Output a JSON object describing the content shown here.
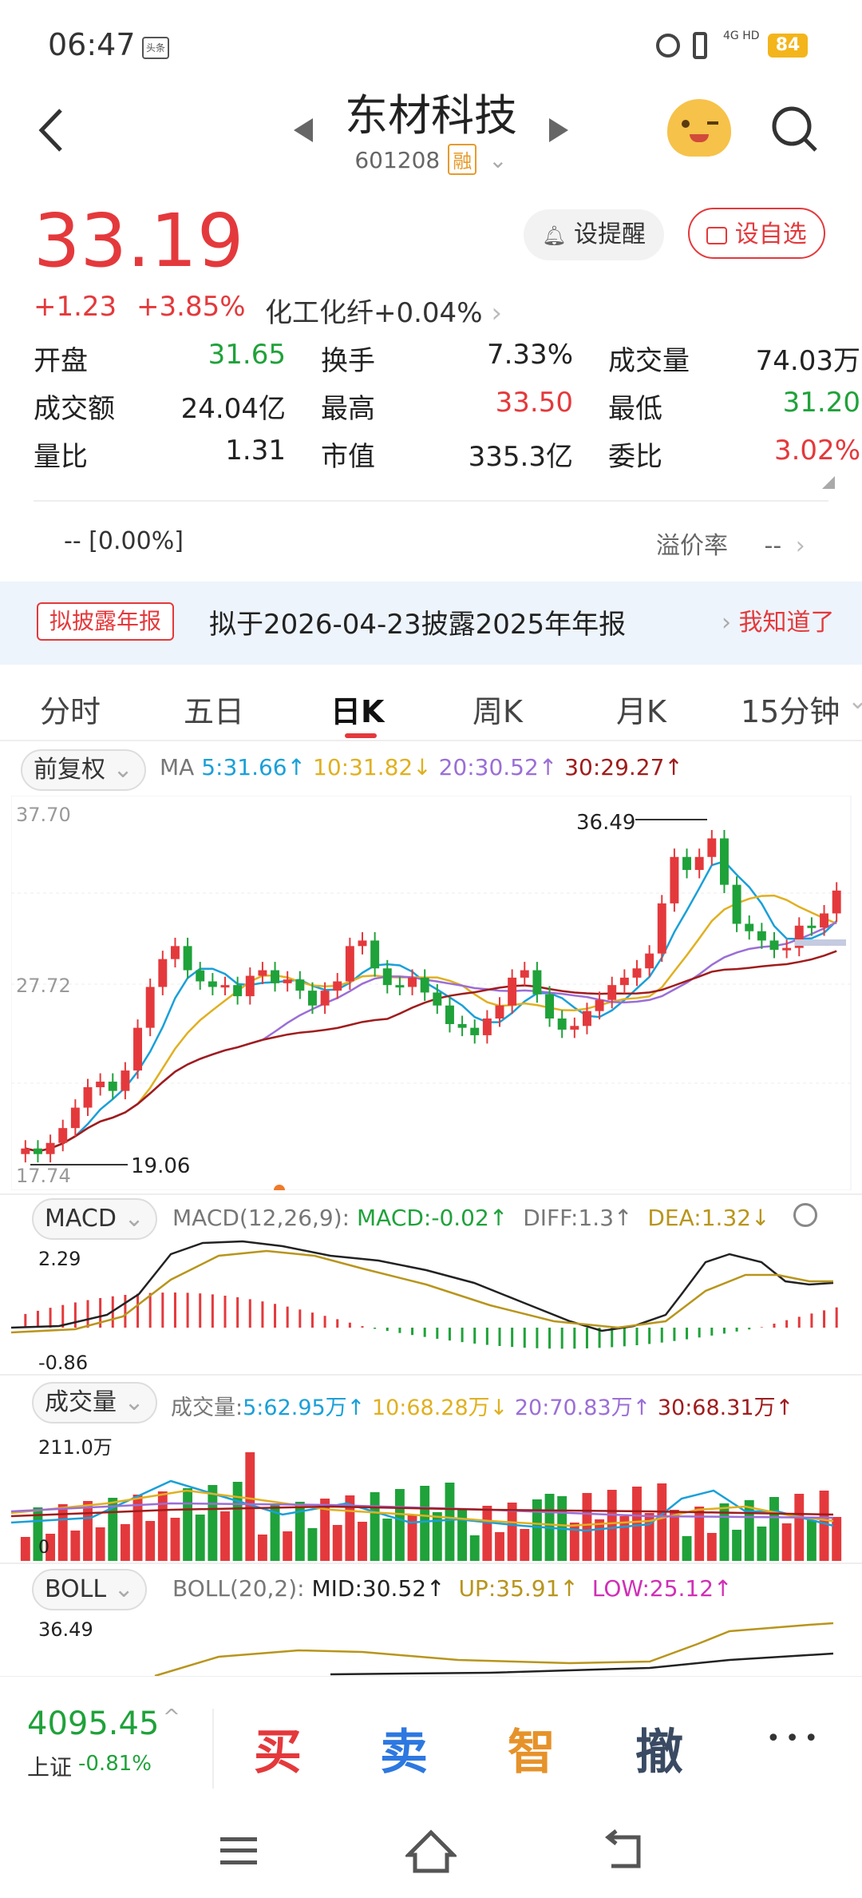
{
  "status": {
    "time": "06:47",
    "badge": "头条",
    "network": "4G HD",
    "battery": "84"
  },
  "header": {
    "title": "东材科技",
    "code": "601208",
    "margin_tag": "融"
  },
  "quote": {
    "price": "33.19",
    "change": "+1.23",
    "change_pct": "+3.85%",
    "sector": "化工化纤",
    "sector_pct": "+0.04%",
    "remind_label": "设提醒",
    "watch_label": "设自选",
    "stats": [
      {
        "k": "开盘",
        "v": "31.65"
      },
      {
        "k": "换手",
        "v": "7.33%"
      },
      {
        "k": "成交量",
        "v": "74.03万"
      },
      {
        "k": "成交额",
        "v": "24.04亿"
      },
      {
        "k": "最高",
        "v": "33.50"
      },
      {
        "k": "最低",
        "v": "31.20"
      },
      {
        "k": "量比",
        "v": "1.31"
      },
      {
        "k": "市值",
        "v": "335.3亿"
      },
      {
        "k": "委比",
        "v": "3.02%"
      }
    ],
    "premium_left": "-- [0.00%]",
    "premium_label": "溢价率",
    "premium_value": "--"
  },
  "notice": {
    "tag": "拟披露年报",
    "text": "拟于2026-04-23披露2025年年报",
    "action": "我知道了"
  },
  "tabs": [
    "分时",
    "五日",
    "日K",
    "周K",
    "月K",
    "15分钟"
  ],
  "active_tab": "日K",
  "kline": {
    "adjust": "前复权",
    "ma_label": "MA",
    "ma": [
      {
        "t": "5:31.66↑",
        "color": "#1aa0d8"
      },
      {
        "t": "10:31.82↓",
        "color": "#e0b020"
      },
      {
        "t": "20:30.52↑",
        "color": "#9b6ed6"
      },
      {
        "t": "30:29.27↑",
        "color": "#a01c1c"
      }
    ],
    "y_top": "37.70",
    "y_mid": "27.72",
    "y_bot": "17.74",
    "high_mark": "36.49",
    "low_mark": "19.06"
  },
  "macd": {
    "sel": "MACD",
    "params": "MACD(12,26,9):",
    "macd": "MACD:-0.02↑",
    "diff": "DIFF:1.3↑",
    "dea": "DEA:1.32↓",
    "y_top": "2.29",
    "y_bot": "-0.86"
  },
  "volume": {
    "sel": "成交量",
    "label": "成交量:",
    "v5": "5:62.95万↑",
    "v10": "10:68.28万↓",
    "v20": "20:70.83万↑",
    "v30": "30:68.31万↑",
    "y_top": "211.0万",
    "y_bot": "0"
  },
  "boll": {
    "sel": "BOLL",
    "params": "BOLL(20,2):",
    "mid": "MID:30.52↑",
    "up": "UP:35.91↑",
    "low": "LOW:25.12↑",
    "y_top": "36.49"
  },
  "chart_data": {
    "type": "candlestick",
    "closes": [
      19.3,
      19.0,
      19.6,
      20.4,
      21.5,
      22.6,
      22.9,
      22.4,
      23.5,
      25.8,
      28.0,
      29.5,
      30.2,
      28.9,
      28.3,
      28.0,
      28.1,
      27.5,
      28.6,
      28.9,
      28.2,
      28.4,
      27.8,
      27.0,
      27.8,
      28.3,
      30.2,
      30.5,
      29.0,
      28.1,
      28.0,
      28.5,
      27.7,
      27.0,
      26.0,
      25.8,
      25.4,
      26.3,
      27.0,
      28.5,
      28.9,
      27.6,
      26.3,
      25.7,
      25.9,
      26.7,
      27.3,
      28.1,
      28.5,
      29.0,
      29.8,
      32.5,
      35.0,
      34.3,
      35.0,
      36.0,
      33.5,
      31.4,
      31.0,
      30.5,
      30.0,
      30.1,
      31.3,
      31.2,
      31.96,
      33.19
    ]
  },
  "bottom": {
    "index_value": "4095.45",
    "index_name": "上证",
    "index_pct": "-0.81%",
    "buy": "买",
    "sell": "卖",
    "smart": "智",
    "cancel": "撤",
    "more": "•••"
  }
}
